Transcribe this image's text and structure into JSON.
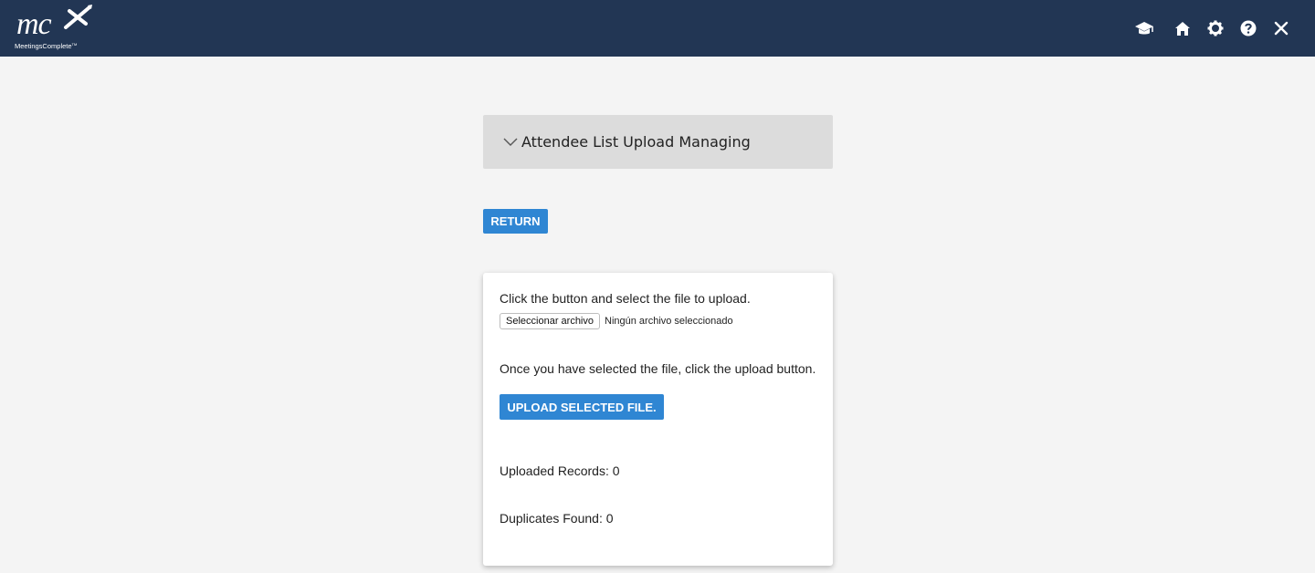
{
  "header": {
    "logo_mark": "mc",
    "logo_text": "MeetingsComplete",
    "logo_tm": "TM",
    "icons": [
      "graduation-cap-icon",
      "home-icon",
      "gear-icon",
      "help-icon",
      "close-icon"
    ],
    "bar_color": "#223654"
  },
  "panel": {
    "title": "Attendee List Upload Managing"
  },
  "return_button": {
    "label": "RETURN"
  },
  "upload_card": {
    "instruction_1": "Click the button and select the file to upload.",
    "file_button_label": "Seleccionar archivo",
    "file_status": "Ningún archivo seleccionado",
    "instruction_2": "Once you have selected the file, click the upload button.",
    "upload_button_label": "UPLOAD SELECTED FILE.",
    "uploaded_records": "Uploaded Records: 0",
    "duplicates_found": "Duplicates Found: 0"
  },
  "colors": {
    "accent": "#2f86d3",
    "background": "#f4f4f4",
    "panel_header": "#dcdcdc"
  }
}
